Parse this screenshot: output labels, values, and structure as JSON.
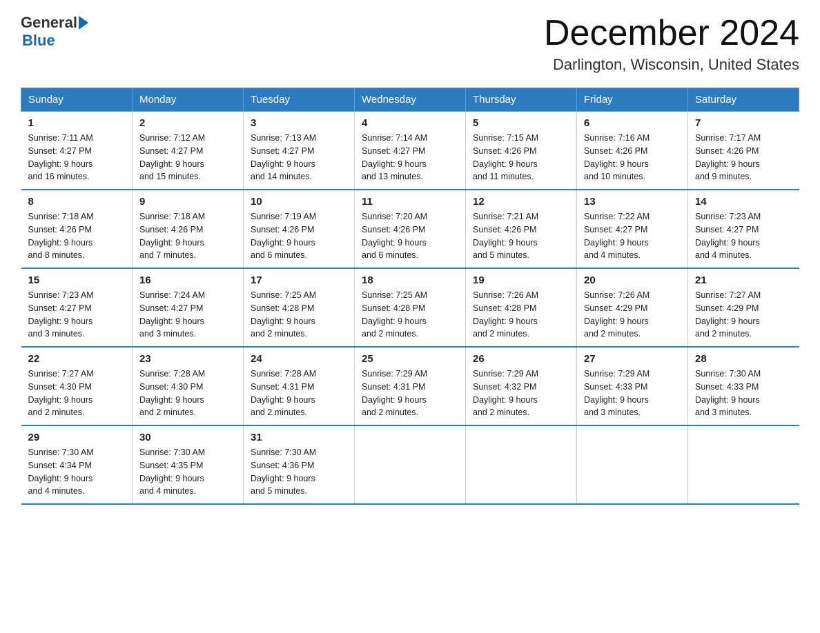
{
  "header": {
    "logo": {
      "general": "General",
      "blue": "Blue"
    },
    "title": "December 2024",
    "subtitle": "Darlington, Wisconsin, United States"
  },
  "calendar": {
    "weekdays": [
      "Sunday",
      "Monday",
      "Tuesday",
      "Wednesday",
      "Thursday",
      "Friday",
      "Saturday"
    ],
    "weeks": [
      [
        {
          "day": "1",
          "sunrise": "7:11 AM",
          "sunset": "4:27 PM",
          "daylight": "9 hours and 16 minutes."
        },
        {
          "day": "2",
          "sunrise": "7:12 AM",
          "sunset": "4:27 PM",
          "daylight": "9 hours and 15 minutes."
        },
        {
          "day": "3",
          "sunrise": "7:13 AM",
          "sunset": "4:27 PM",
          "daylight": "9 hours and 14 minutes."
        },
        {
          "day": "4",
          "sunrise": "7:14 AM",
          "sunset": "4:27 PM",
          "daylight": "9 hours and 13 minutes."
        },
        {
          "day": "5",
          "sunrise": "7:15 AM",
          "sunset": "4:26 PM",
          "daylight": "9 hours and 11 minutes."
        },
        {
          "day": "6",
          "sunrise": "7:16 AM",
          "sunset": "4:26 PM",
          "daylight": "9 hours and 10 minutes."
        },
        {
          "day": "7",
          "sunrise": "7:17 AM",
          "sunset": "4:26 PM",
          "daylight": "9 hours and 9 minutes."
        }
      ],
      [
        {
          "day": "8",
          "sunrise": "7:18 AM",
          "sunset": "4:26 PM",
          "daylight": "9 hours and 8 minutes."
        },
        {
          "day": "9",
          "sunrise": "7:18 AM",
          "sunset": "4:26 PM",
          "daylight": "9 hours and 7 minutes."
        },
        {
          "day": "10",
          "sunrise": "7:19 AM",
          "sunset": "4:26 PM",
          "daylight": "9 hours and 6 minutes."
        },
        {
          "day": "11",
          "sunrise": "7:20 AM",
          "sunset": "4:26 PM",
          "daylight": "9 hours and 6 minutes."
        },
        {
          "day": "12",
          "sunrise": "7:21 AM",
          "sunset": "4:26 PM",
          "daylight": "9 hours and 5 minutes."
        },
        {
          "day": "13",
          "sunrise": "7:22 AM",
          "sunset": "4:27 PM",
          "daylight": "9 hours and 4 minutes."
        },
        {
          "day": "14",
          "sunrise": "7:23 AM",
          "sunset": "4:27 PM",
          "daylight": "9 hours and 4 minutes."
        }
      ],
      [
        {
          "day": "15",
          "sunrise": "7:23 AM",
          "sunset": "4:27 PM",
          "daylight": "9 hours and 3 minutes."
        },
        {
          "day": "16",
          "sunrise": "7:24 AM",
          "sunset": "4:27 PM",
          "daylight": "9 hours and 3 minutes."
        },
        {
          "day": "17",
          "sunrise": "7:25 AM",
          "sunset": "4:28 PM",
          "daylight": "9 hours and 2 minutes."
        },
        {
          "day": "18",
          "sunrise": "7:25 AM",
          "sunset": "4:28 PM",
          "daylight": "9 hours and 2 minutes."
        },
        {
          "day": "19",
          "sunrise": "7:26 AM",
          "sunset": "4:28 PM",
          "daylight": "9 hours and 2 minutes."
        },
        {
          "day": "20",
          "sunrise": "7:26 AM",
          "sunset": "4:29 PM",
          "daylight": "9 hours and 2 minutes."
        },
        {
          "day": "21",
          "sunrise": "7:27 AM",
          "sunset": "4:29 PM",
          "daylight": "9 hours and 2 minutes."
        }
      ],
      [
        {
          "day": "22",
          "sunrise": "7:27 AM",
          "sunset": "4:30 PM",
          "daylight": "9 hours and 2 minutes."
        },
        {
          "day": "23",
          "sunrise": "7:28 AM",
          "sunset": "4:30 PM",
          "daylight": "9 hours and 2 minutes."
        },
        {
          "day": "24",
          "sunrise": "7:28 AM",
          "sunset": "4:31 PM",
          "daylight": "9 hours and 2 minutes."
        },
        {
          "day": "25",
          "sunrise": "7:29 AM",
          "sunset": "4:31 PM",
          "daylight": "9 hours and 2 minutes."
        },
        {
          "day": "26",
          "sunrise": "7:29 AM",
          "sunset": "4:32 PM",
          "daylight": "9 hours and 2 minutes."
        },
        {
          "day": "27",
          "sunrise": "7:29 AM",
          "sunset": "4:33 PM",
          "daylight": "9 hours and 3 minutes."
        },
        {
          "day": "28",
          "sunrise": "7:30 AM",
          "sunset": "4:33 PM",
          "daylight": "9 hours and 3 minutes."
        }
      ],
      [
        {
          "day": "29",
          "sunrise": "7:30 AM",
          "sunset": "4:34 PM",
          "daylight": "9 hours and 4 minutes."
        },
        {
          "day": "30",
          "sunrise": "7:30 AM",
          "sunset": "4:35 PM",
          "daylight": "9 hours and 4 minutes."
        },
        {
          "day": "31",
          "sunrise": "7:30 AM",
          "sunset": "4:36 PM",
          "daylight": "9 hours and 5 minutes."
        },
        null,
        null,
        null,
        null
      ]
    ],
    "labels": {
      "sunrise": "Sunrise:",
      "sunset": "Sunset:",
      "daylight": "Daylight:"
    }
  }
}
